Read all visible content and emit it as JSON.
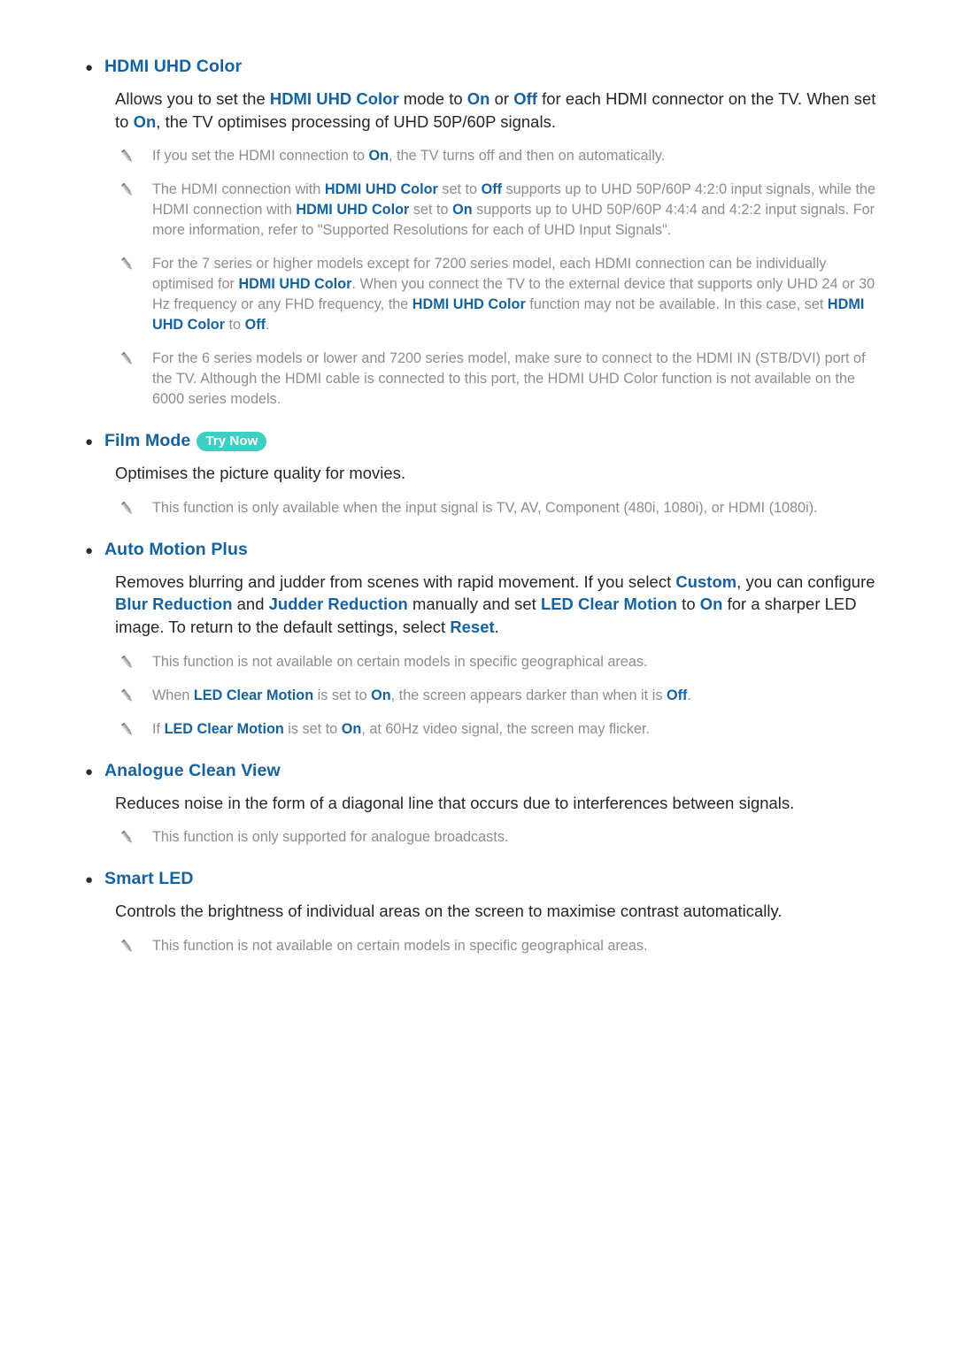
{
  "document": {
    "page_background": "#ffffff",
    "heading_color": "#16619f",
    "body_color": "#262626",
    "note_color": "#8d8d8d",
    "badge_color": "#3dcfc3",
    "bullet_glyph": "●",
    "note_icon_name": "pencil-icon"
  },
  "sections": [
    {
      "id": "hdmi-uhd-color",
      "heading": "HDMI UHD Color",
      "badge": null,
      "body": [
        {
          "t": "Allows you to set the ",
          "s": "plain"
        },
        {
          "t": "HDMI UHD Color",
          "s": "hl"
        },
        {
          "t": " mode to ",
          "s": "plain"
        },
        {
          "t": "On",
          "s": "hl"
        },
        {
          "t": " or ",
          "s": "plain"
        },
        {
          "t": "Off",
          "s": "hl"
        },
        {
          "t": " for each HDMI connector on the TV. When set to ",
          "s": "plain"
        },
        {
          "t": "On",
          "s": "hl"
        },
        {
          "t": ", the TV optimises processing of UHD 50P/60P signals.",
          "s": "plain"
        }
      ],
      "notes": [
        [
          {
            "t": "If you set the HDMI connection to ",
            "s": "plain"
          },
          {
            "t": "On",
            "s": "hl"
          },
          {
            "t": ", the TV turns off and then on automatically.",
            "s": "plain"
          }
        ],
        [
          {
            "t": "The HDMI connection with ",
            "s": "plain"
          },
          {
            "t": "HDMI UHD Color",
            "s": "hl"
          },
          {
            "t": " set to ",
            "s": "plain"
          },
          {
            "t": "Off",
            "s": "hl"
          },
          {
            "t": " supports up to UHD 50P/60P 4:2:0 input signals, while the HDMI connection with ",
            "s": "plain"
          },
          {
            "t": "HDMI UHD Color",
            "s": "hl"
          },
          {
            "t": " set to ",
            "s": "plain"
          },
          {
            "t": "On",
            "s": "hl"
          },
          {
            "t": " supports up to UHD 50P/60P 4:4:4 and 4:2:2 input signals. For more information, refer to \"Supported Resolutions for each of UHD Input Signals\".",
            "s": "plain"
          }
        ],
        [
          {
            "t": "For the 7 series or higher models except for 7200 series model, each HDMI connection can be individually optimised for ",
            "s": "plain"
          },
          {
            "t": "HDMI UHD Color",
            "s": "hl"
          },
          {
            "t": ". When you connect the TV to the external device that supports only UHD 24 or 30 Hz frequency or any FHD frequency, the ",
            "s": "plain"
          },
          {
            "t": "HDMI UHD Color",
            "s": "hl"
          },
          {
            "t": " function may not be available. In this case, set ",
            "s": "plain"
          },
          {
            "t": "HDMI UHD Color",
            "s": "hl"
          },
          {
            "t": " to ",
            "s": "plain"
          },
          {
            "t": "Off",
            "s": "hl"
          },
          {
            "t": ".",
            "s": "plain"
          }
        ],
        [
          {
            "t": "For the 6 series models or lower and 7200 series model, make sure to connect to the HDMI IN (STB/DVI) port of the TV. Although the HDMI cable is connected to this port, the HDMI UHD Color function is not available on the 6000 series models.",
            "s": "plain"
          }
        ]
      ]
    },
    {
      "id": "film-mode",
      "heading": "Film Mode",
      "badge": "Try Now",
      "body": [
        {
          "t": "Optimises the picture quality for movies.",
          "s": "plain"
        }
      ],
      "notes": [
        [
          {
            "t": "This function is only available when the input signal is TV, AV, Component (480i, 1080i), or HDMI (1080i).",
            "s": "plain"
          }
        ]
      ]
    },
    {
      "id": "auto-motion-plus",
      "heading": "Auto Motion Plus",
      "badge": null,
      "body": [
        {
          "t": "Removes blurring and judder from scenes with rapid movement. If you select ",
          "s": "plain"
        },
        {
          "t": "Custom",
          "s": "hl"
        },
        {
          "t": ", you can configure ",
          "s": "plain"
        },
        {
          "t": "Blur Reduction",
          "s": "hl"
        },
        {
          "t": " and ",
          "s": "plain"
        },
        {
          "t": "Judder Reduction",
          "s": "hl"
        },
        {
          "t": " manually and set ",
          "s": "plain"
        },
        {
          "t": "LED Clear Motion",
          "s": "hl"
        },
        {
          "t": " to ",
          "s": "plain"
        },
        {
          "t": "On",
          "s": "hl"
        },
        {
          "t": " for a sharper LED image. To return to the default settings, select ",
          "s": "plain"
        },
        {
          "t": "Reset",
          "s": "hl"
        },
        {
          "t": ".",
          "s": "plain"
        }
      ],
      "notes": [
        [
          {
            "t": "This function is not available on certain models in specific geographical areas.",
            "s": "plain"
          }
        ],
        [
          {
            "t": "When ",
            "s": "plain"
          },
          {
            "t": "LED Clear Motion",
            "s": "hl"
          },
          {
            "t": " is set to ",
            "s": "plain"
          },
          {
            "t": "On",
            "s": "hl"
          },
          {
            "t": ", the screen appears darker than when it is ",
            "s": "plain"
          },
          {
            "t": "Off",
            "s": "hl"
          },
          {
            "t": ".",
            "s": "plain"
          }
        ],
        [
          {
            "t": "If ",
            "s": "plain"
          },
          {
            "t": "LED Clear Motion",
            "s": "hl"
          },
          {
            "t": " is set to ",
            "s": "plain"
          },
          {
            "t": "On",
            "s": "hl"
          },
          {
            "t": ", at 60Hz video signal, the screen may flicker.",
            "s": "plain"
          }
        ]
      ]
    },
    {
      "id": "analogue-clean-view",
      "heading": "Analogue Clean View",
      "badge": null,
      "body": [
        {
          "t": "Reduces noise in the form of a diagonal line that occurs due to interferences between signals.",
          "s": "plain"
        }
      ],
      "notes": [
        [
          {
            "t": "This function is only supported for analogue broadcasts.",
            "s": "plain"
          }
        ]
      ]
    },
    {
      "id": "smart-led",
      "heading": "Smart LED",
      "badge": null,
      "body": [
        {
          "t": "Controls the brightness of individual areas on the screen to maximise contrast automatically.",
          "s": "plain"
        }
      ],
      "notes": [
        [
          {
            "t": "This function is not available on certain models in specific geographical areas.",
            "s": "plain"
          }
        ]
      ]
    }
  ]
}
